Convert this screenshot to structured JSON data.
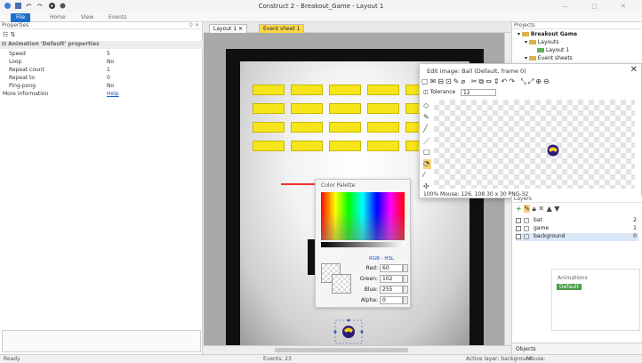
{
  "window": {
    "title": "Construct 2 - Breakout_Game - Layout 1"
  },
  "ribbon": {
    "tabs": [
      "File",
      "Home",
      "View",
      "Events"
    ]
  },
  "properties": {
    "header": "Properties",
    "section": "Animation 'Default' properties",
    "rows": [
      {
        "key": "Speed",
        "value": "5"
      },
      {
        "key": "Loop",
        "value": "No"
      },
      {
        "key": "Repeat count",
        "value": "1"
      },
      {
        "key": "Repeat to",
        "value": "0"
      },
      {
        "key": "Ping-pong",
        "value": "No"
      },
      {
        "key": "More information",
        "value": "Help"
      }
    ]
  },
  "layout_tabs": [
    "Layout 1",
    "Event sheet 1"
  ],
  "projects": {
    "header": "Projects",
    "items": [
      "Breakout Game",
      "Layouts",
      "Layout 1",
      "Event sheets"
    ]
  },
  "image_editor": {
    "title": "Edit image: Ball (Default, frame 0)",
    "tolerance_label": "Tolerance",
    "tolerance_value": "12",
    "status": "100%  Mouse: 126, 108      30 x 30  PNG-32"
  },
  "color_palette": {
    "title": "Color Palette",
    "mode_link": "RGB - HSL",
    "red_label": "Red:",
    "red": "60",
    "green_label": "Green:",
    "green": "102",
    "blue_label": "Blue:",
    "blue": "255",
    "alpha_label": "Alpha:",
    "alpha": "0"
  },
  "layers": {
    "header": "Layers",
    "rows": [
      {
        "name": "bat",
        "count": "2"
      },
      {
        "name": "game",
        "count": "1"
      },
      {
        "name": "background",
        "count": "0"
      }
    ],
    "animations_title": "Animations",
    "animation_default": "Default",
    "objects_tab": "Objects"
  },
  "status": {
    "left": "Ready",
    "events": "Events: 23",
    "active_layer": "Active layer: background",
    "mouse": "Mouse:"
  },
  "colors": {
    "brick": "#f6e51a",
    "accent": "#1e6ecf",
    "event_tab": "#ffd84a"
  }
}
